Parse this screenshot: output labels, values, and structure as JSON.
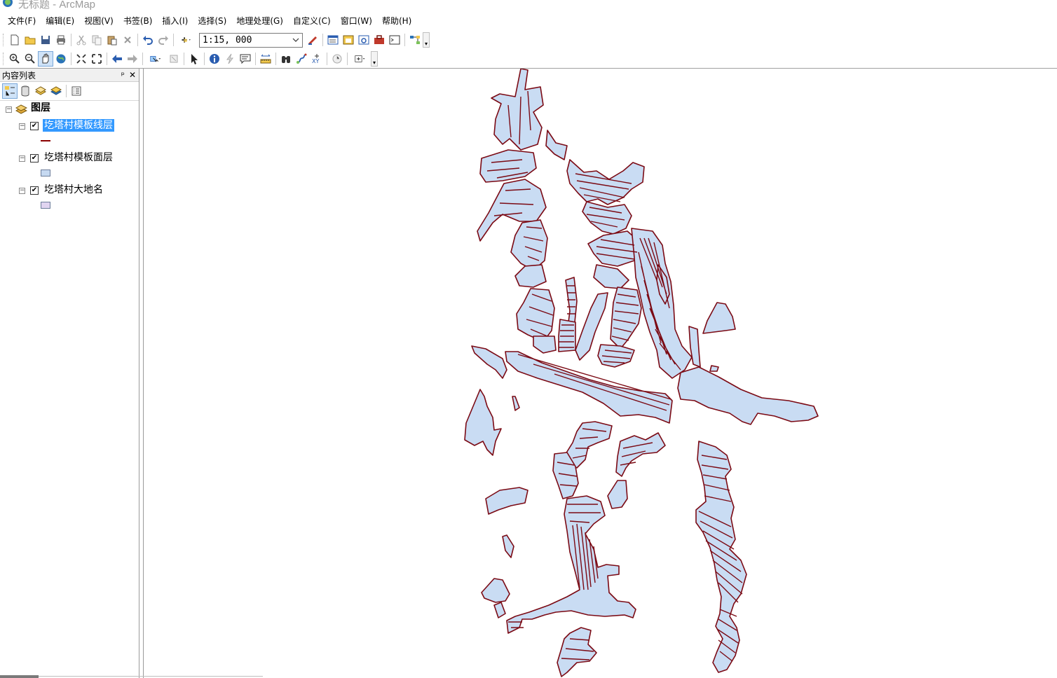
{
  "window": {
    "title": "无标题 - ArcMap"
  },
  "menu": [
    "文件(F)",
    "编辑(E)",
    "视图(V)",
    "书签(B)",
    "插入(I)",
    "选择(S)",
    "地理处理(G)",
    "自定义(C)",
    "窗口(W)",
    "帮助(H)"
  ],
  "toolbar": {
    "scale_value": "1:15, 000"
  },
  "toc": {
    "title": "内容列表",
    "pin_glyph": "ᵖ",
    "close_glyph": "✕",
    "group_label": "图层",
    "layers": [
      {
        "label": "圪塔村模板线层",
        "checked": true,
        "symbol": "line",
        "color": "#8b0000"
      },
      {
        "label": "圪塔村模板面层",
        "checked": true,
        "symbol": "fill",
        "color": "#c6d9f1"
      },
      {
        "label": "圪塔村大地名",
        "checked": true,
        "symbol": "fill",
        "color": "#e0d4f0"
      }
    ]
  },
  "map": {
    "fill_color": "#c9dcf3",
    "stroke_color": "#7b0a14"
  }
}
